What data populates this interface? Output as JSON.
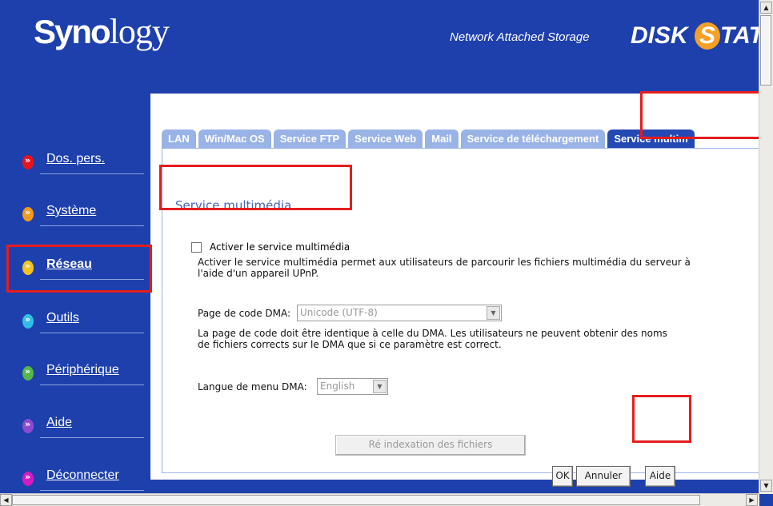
{
  "header": {
    "logo_bold": "Syno",
    "logo_light": "logy",
    "tagline": "Network Attached Storage",
    "brand_prefix": "DISK",
    "brand_s": "S",
    "brand_suffix": "TATI"
  },
  "sidebar": {
    "items": [
      {
        "label": "Dos. pers.",
        "icon": "red-orb-icon",
        "color": "#e8141c"
      },
      {
        "label": "Système",
        "icon": "orange-orb-icon",
        "color": "#f29a1e"
      },
      {
        "label": "Réseau",
        "icon": "yellow-orb-icon",
        "color": "#f2c21e"
      },
      {
        "label": "Outils",
        "icon": "cyan-orb-icon",
        "color": "#33bde6"
      },
      {
        "label": "Périphérique",
        "icon": "green-orb-icon",
        "color": "#52b848"
      },
      {
        "label": "Aide",
        "icon": "purple-orb-icon",
        "color": "#8a4bd0"
      },
      {
        "label": "Déconnecter",
        "icon": "magenta-orb-icon",
        "color": "#d21cc2"
      }
    ]
  },
  "tabs": [
    "LAN",
    "Win/Mac OS",
    "Service FTP",
    "Service Web",
    "Mail",
    "Service de téléchargement",
    "Service multim"
  ],
  "content": {
    "title": "Service multimédia",
    "enable_label": "Activer le service multimédia",
    "enable_desc_1": "Activer le service multimédia permet aux utilisateurs de parcourir les fichiers multimédia du serveur à",
    "enable_desc_2": "l'aide d'un appareil UPnP.",
    "codepage_label": "Page de code DMA:",
    "codepage_value": "Unicode (UTF-8)",
    "codepage_desc_1": "La page de code doit être identique à celle du DMA. Les utilisateurs ne peuvent obtenir des noms",
    "codepage_desc_2": "de fichiers corrects sur le DMA que si ce paramètre est correct.",
    "menu_lang_label": "Langue de menu DMA:",
    "menu_lang_value": "English",
    "reindex_label": "Ré indexation des fichiers",
    "ok_label": "OK",
    "cancel_label": "Annuler",
    "help_label": "Aide"
  },
  "colors": {
    "background": "#1e40ad",
    "tab": "#9ab3e7",
    "tab_active": "#2549b3",
    "highlight": "#e51d1d"
  }
}
